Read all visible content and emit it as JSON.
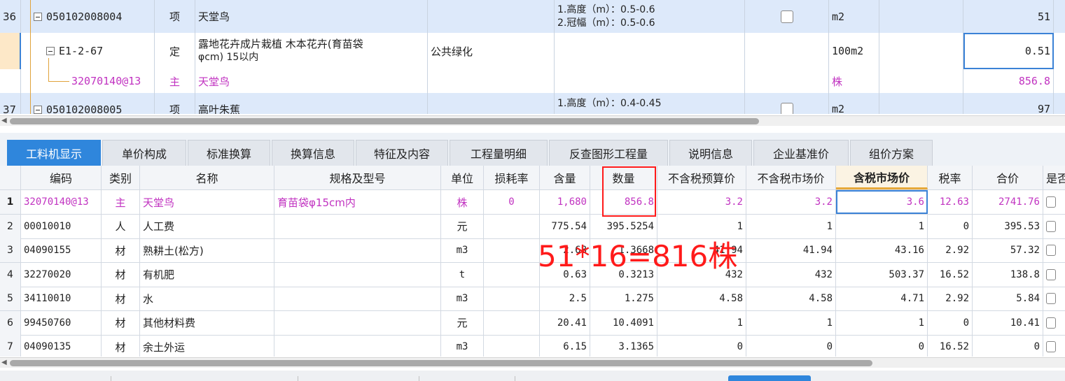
{
  "upper_rows": [
    {
      "no": "36",
      "code": "050102008004",
      "type": "项",
      "name": "天堂鸟",
      "feature": "",
      "desc_line1": "1.高度（m）：0.5-0.6",
      "desc_line2": "2.冠幅（m）：0.5-0.6",
      "unit": "m2",
      "qty": "51"
    },
    {
      "no": "",
      "code": "E1-2-67",
      "type": "定",
      "name_line1": "露地花卉成片栽植 木本花卉(育苗袋",
      "name_line2": "φcm) 15以内",
      "feature": "公共绿化",
      "unit": "100m2",
      "qty": "0.51"
    },
    {
      "no": "",
      "code": "32070140@13",
      "type": "主",
      "name": "天堂鸟",
      "unit": "株",
      "qty": "856.8"
    },
    {
      "no": "37",
      "code": "050102008005",
      "type": "项",
      "name": "高叶朱蕉",
      "desc_line1": "1.高度（m）：0.4-0.45",
      "unit": "m2",
      "qty": "97"
    }
  ],
  "tabs": [
    "工料机显示",
    "单价构成",
    "标准换算",
    "换算信息",
    "特征及内容",
    "工程量明细",
    "反查图形工程量",
    "说明信息",
    "企业基准价",
    "组价方案"
  ],
  "grid": {
    "headers": [
      "编码",
      "类别",
      "名称",
      "规格及型号",
      "单位",
      "损耗率",
      "含量",
      "数量",
      "不含税预算价",
      "不含税市场价",
      "含税市场价",
      "税率",
      "合价",
      "是否"
    ],
    "rows": [
      {
        "n": "1",
        "code": "32070140@13",
        "cat": "主",
        "name": "天堂鸟",
        "spec": "育苗袋φ15cm内",
        "unit": "株",
        "loss": "0",
        "content": "1,680",
        "qty": "856.8",
        "budget": "3.2",
        "market": "3.2",
        "market_tax": "3.6",
        "rate": "12.63",
        "total": "2741.76"
      },
      {
        "n": "2",
        "code": "00010010",
        "cat": "人",
        "name": "人工费",
        "spec": "",
        "unit": "元",
        "loss": "",
        "content": "775.54",
        "qty": "395.5254",
        "budget": "1",
        "market": "1",
        "market_tax": "1",
        "rate": "0",
        "total": "395.53"
      },
      {
        "n": "3",
        "code": "04090155",
        "cat": "材",
        "name": "熟耕土(松方)",
        "spec": "",
        "unit": "m3",
        "loss": "",
        "content": "2.68",
        "qty": "1.3668",
        "budget": "41.94",
        "market": "41.94",
        "market_tax": "43.16",
        "rate": "2.92",
        "total": "57.32"
      },
      {
        "n": "4",
        "code": "32270020",
        "cat": "材",
        "name": "有机肥",
        "spec": "",
        "unit": "t",
        "loss": "",
        "content": "0.63",
        "qty": "0.3213",
        "budget": "432",
        "market": "432",
        "market_tax": "503.37",
        "rate": "16.52",
        "total": "138.8"
      },
      {
        "n": "5",
        "code": "34110010",
        "cat": "材",
        "name": "水",
        "spec": "",
        "unit": "m3",
        "loss": "",
        "content": "2.5",
        "qty": "1.275",
        "budget": "4.58",
        "market": "4.58",
        "market_tax": "4.71",
        "rate": "2.92",
        "total": "5.84"
      },
      {
        "n": "6",
        "code": "99450760",
        "cat": "材",
        "name": "其他材料费",
        "spec": "",
        "unit": "元",
        "loss": "",
        "content": "20.41",
        "qty": "10.4091",
        "budget": "1",
        "market": "1",
        "market_tax": "1",
        "rate": "0",
        "total": "10.41"
      },
      {
        "n": "7",
        "code": "04090135",
        "cat": "材",
        "name": "余土外运",
        "spec": "",
        "unit": "m3",
        "loss": "",
        "content": "6.15",
        "qty": "3.1365",
        "budget": "0",
        "market": "0",
        "market_tax": "0",
        "rate": "16.52",
        "total": "0"
      }
    ]
  },
  "annotation": "51*16=816株",
  "colors": {
    "accent": "#2f86dc",
    "highlight_red": "#ff1a1a",
    "main_material": "#c133c1",
    "item_row_bg": "#dde9fa"
  }
}
